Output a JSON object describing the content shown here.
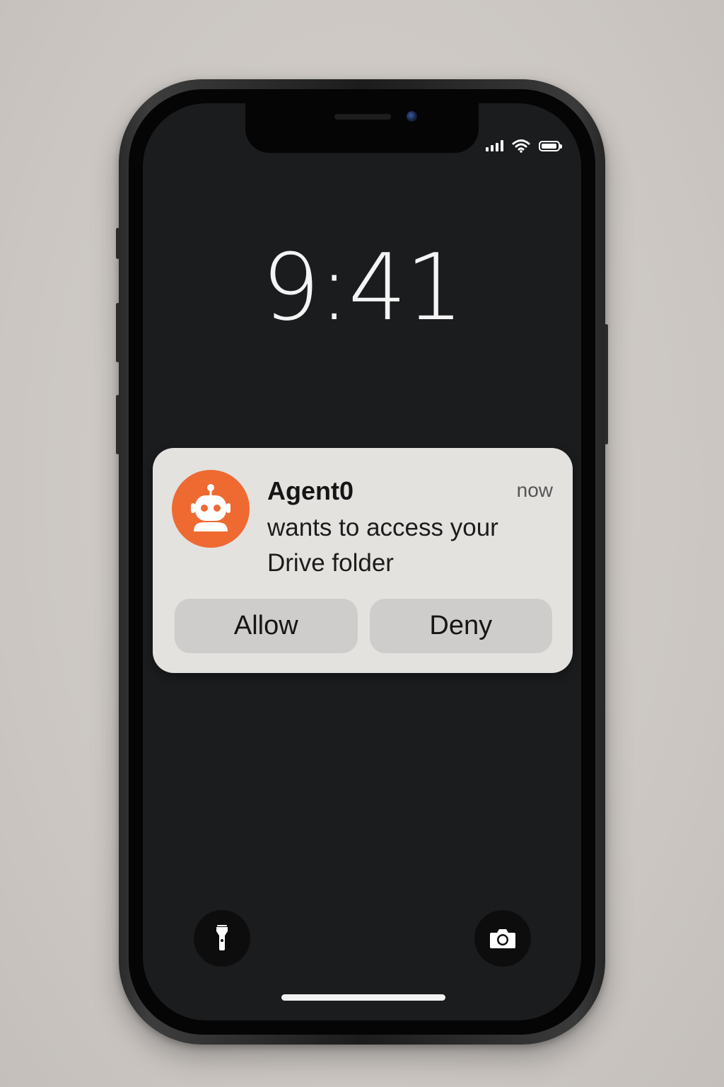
{
  "status_bar": {
    "signal_icon": "cellular-signal-icon",
    "wifi_icon": "wifi-icon",
    "battery_icon": "battery-icon",
    "battery_level": 0.95
  },
  "lock_screen": {
    "time": "9:41"
  },
  "notification": {
    "app_icon": "robot-icon",
    "app_icon_color": "#ee6a31",
    "app_name": "Agent0",
    "timestamp": "now",
    "message": "wants to access your Drive folder",
    "actions": {
      "allow_label": "Allow",
      "deny_label": "Deny"
    }
  },
  "quick_actions": {
    "left_icon": "flashlight-icon",
    "right_icon": "camera-icon"
  }
}
